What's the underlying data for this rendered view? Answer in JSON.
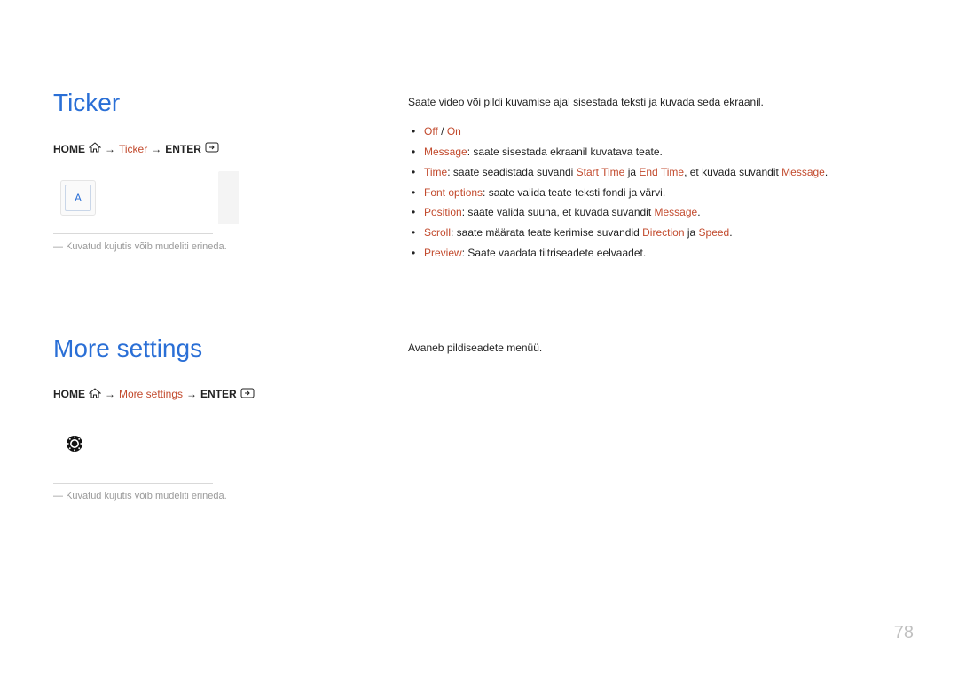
{
  "sections": {
    "ticker": {
      "heading": "Ticker",
      "breadcrumb": {
        "home": "HOME",
        "arrow": "→",
        "item": "Ticker",
        "enter": "ENTER"
      },
      "graphic_letter": "A",
      "note_prefix": "―",
      "note": "Kuvatud kujutis võib mudeliti erineda.",
      "desc": "Saate video või pildi kuvamise ajal sisestada teksti ja kuvada seda ekraanil.",
      "items": {
        "offon": {
          "off": "Off",
          "sep": " / ",
          "on": "On"
        },
        "message": {
          "label": "Message",
          "text": ": saate sisestada ekraanil kuvatava teate."
        },
        "time": {
          "label": "Time",
          "t1": ": saate seadistada suvandi ",
          "start": "Start Time",
          "t2": " ja ",
          "end": "End Time",
          "t3": ", et kuvada suvandit ",
          "msg": "Message",
          "t4": "."
        },
        "font": {
          "label": "Font options",
          "text": ": saate valida teate teksti fondi ja värvi."
        },
        "position": {
          "label": "Position",
          "t1": ": saate valida suuna, et kuvada suvandit ",
          "msg": "Message",
          "t2": "."
        },
        "scroll": {
          "label": "Scroll",
          "t1": ": saate määrata teate kerimise suvandid ",
          "dir": "Direction",
          "t2": " ja ",
          "speed": "Speed",
          "t3": "."
        },
        "preview": {
          "label": "Preview",
          "text": ": Saate vaadata tiitriseadete eelvaadet."
        }
      }
    },
    "more": {
      "heading": "More settings",
      "breadcrumb": {
        "home": "HOME",
        "arrow": "→",
        "item": "More settings",
        "enter": "ENTER"
      },
      "note_prefix": "―",
      "note": "Kuvatud kujutis võib mudeliti erineda.",
      "desc": "Avaneb pildiseadete menüü."
    }
  },
  "page_number": "78"
}
